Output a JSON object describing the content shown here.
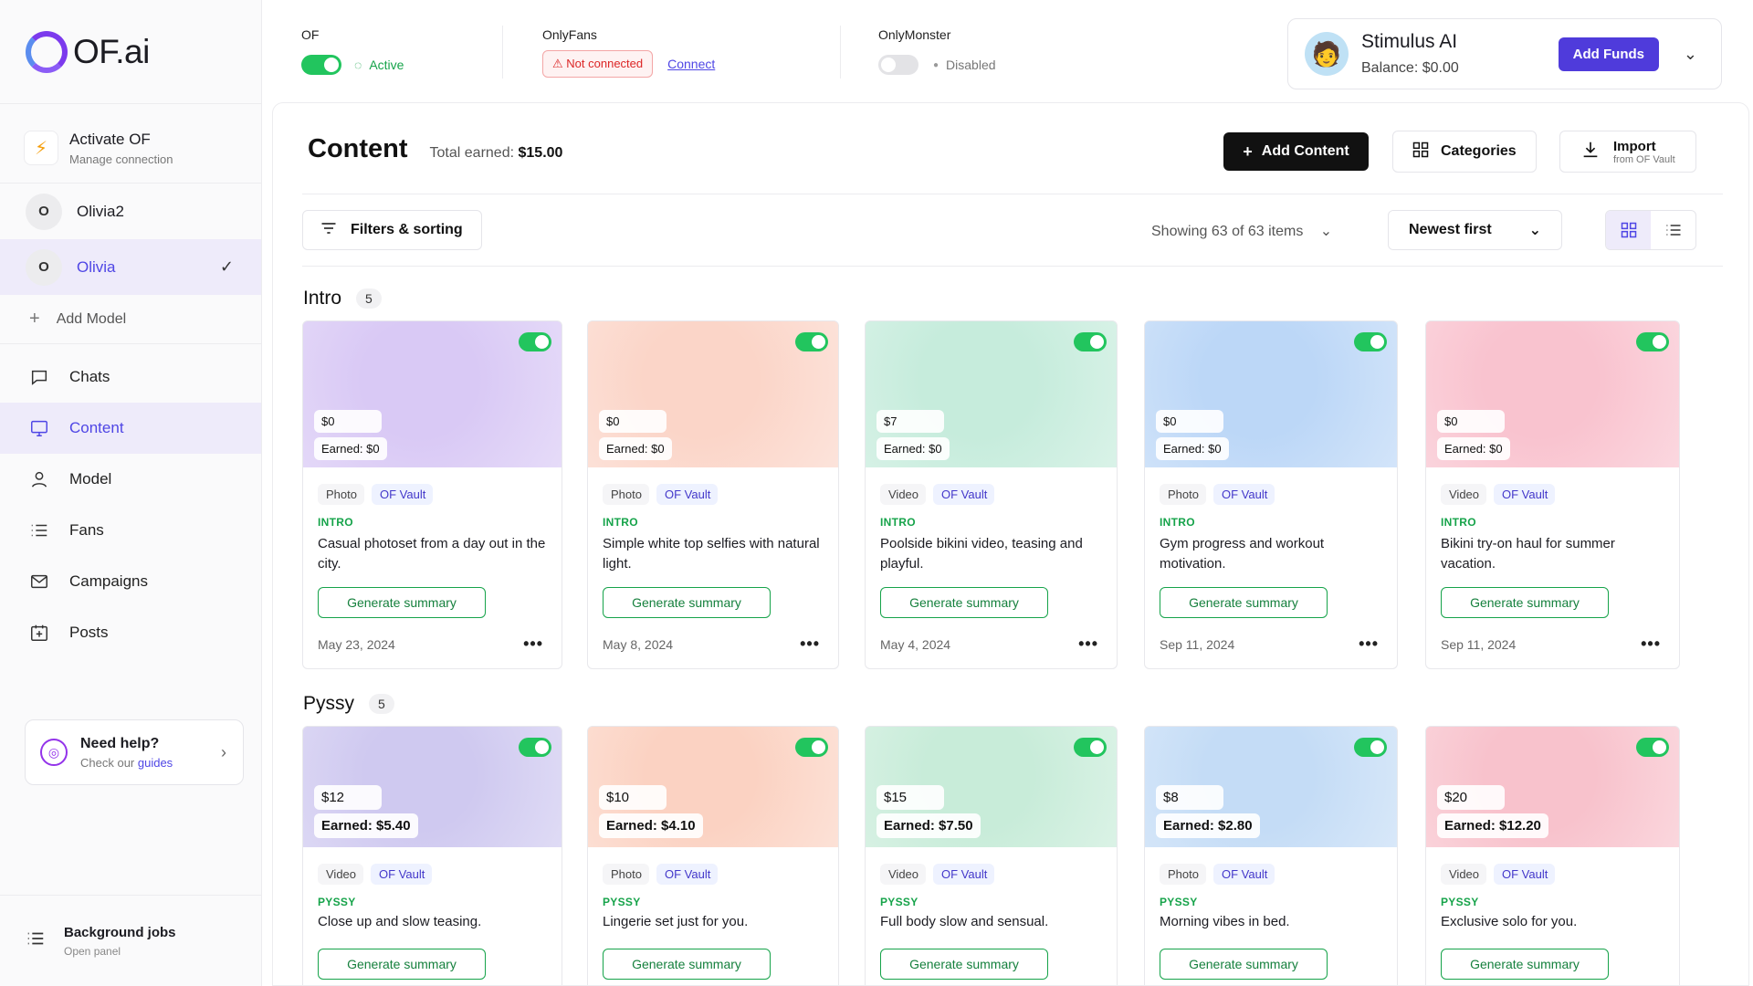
{
  "brand": {
    "name": "OF.ai"
  },
  "sidebar": {
    "activate": {
      "title": "Activate OF",
      "subtitle": "Manage connection"
    },
    "models": [
      {
        "initial": "O",
        "name": "Olivia2",
        "active": false
      },
      {
        "initial": "O",
        "name": "Olivia",
        "active": true
      }
    ],
    "add_model": "Add Model",
    "nav": [
      {
        "label": "Chats",
        "icon": "chat-icon"
      },
      {
        "label": "Content",
        "icon": "monitor-icon",
        "active": true
      },
      {
        "label": "Model",
        "icon": "person-icon"
      },
      {
        "label": "Fans",
        "icon": "list-icon"
      },
      {
        "label": "Campaigns",
        "icon": "mail-icon"
      },
      {
        "label": "Posts",
        "icon": "calendar-plus-icon"
      }
    ],
    "help": {
      "title": "Need help?",
      "sub_prefix": "Check our",
      "sub_link": "guides"
    },
    "background_jobs": {
      "title": "Background jobs",
      "subtitle": "Open panel"
    }
  },
  "topbar": {
    "of": {
      "label": "OF",
      "status": "Active"
    },
    "onlyfans": {
      "label": "OnlyFans",
      "status": "Not connected",
      "action": "Connect"
    },
    "onlymonster": {
      "label": "OnlyMonster",
      "status": "Disabled"
    },
    "account": {
      "name": "Stimulus AI",
      "balance": "Balance: $0.00",
      "add_funds": "Add Funds"
    }
  },
  "content": {
    "title": "Content",
    "total_label": "Total earned:",
    "total_value": "$15.00",
    "add_content": "Add Content",
    "categories": "Categories",
    "import_title": "Import",
    "import_sub": "from OF Vault",
    "filters": "Filters & sorting",
    "showing": "Showing 63 of 63 items",
    "sort": "Newest first",
    "generate_label": "Generate summary"
  },
  "sections": [
    {
      "title": "Intro",
      "count": "5",
      "cards": [
        {
          "price": "$0",
          "earned": "Earned: $0",
          "type": "Photo",
          "source": "OF Vault",
          "category": "INTRO",
          "desc": "Casual photoset from a day out in the city.",
          "date": "May 23, 2024",
          "color": "#d9c9f5"
        },
        {
          "price": "$0",
          "earned": "Earned: $0",
          "type": "Photo",
          "source": "OF Vault",
          "category": "INTRO",
          "desc": "Simple white top selfies with natural light.",
          "date": "May 8, 2024",
          "color": "#fbd5c8"
        },
        {
          "price": "$7",
          "earned": "Earned: $0",
          "type": "Video",
          "source": "OF Vault",
          "category": "INTRO",
          "desc": "Poolside bikini video, teasing and playful.",
          "date": "May 4, 2024",
          "color": "#c6ecdc"
        },
        {
          "price": "$0",
          "earned": "Earned: $0",
          "type": "Photo",
          "source": "OF Vault",
          "category": "INTRO",
          "desc": "Gym progress and workout motivation.",
          "date": "Sep 11, 2024",
          "color": "#bcd7f7"
        },
        {
          "price": "$0",
          "earned": "Earned: $0",
          "type": "Video",
          "source": "OF Vault",
          "category": "INTRO",
          "desc": "Bikini try-on haul for summer vacation.",
          "date": "Sep 11, 2024",
          "color": "#f9c3cf"
        }
      ]
    },
    {
      "title": "Pyssy",
      "count": "5",
      "cards": [
        {
          "price": "$12",
          "earned": "Earned: $5.40",
          "type": "Video",
          "source": "OF Vault",
          "category": "PYSSY",
          "desc": "Close up and slow teasing.",
          "color": "#cfc9f0"
        },
        {
          "price": "$10",
          "earned": "Earned: $4.10",
          "type": "Photo",
          "source": "OF Vault",
          "category": "PYSSY",
          "desc": "Lingerie set just for you.",
          "color": "#fbd2c2"
        },
        {
          "price": "$15",
          "earned": "Earned: $7.50",
          "type": "Video",
          "source": "OF Vault",
          "category": "PYSSY",
          "desc": "Full body slow and sensual.",
          "color": "#c8ecd9"
        },
        {
          "price": "$8",
          "earned": "Earned: $2.80",
          "type": "Photo",
          "source": "OF Vault",
          "category": "PYSSY",
          "desc": "Morning vibes in bed.",
          "color": "#c4dcf6"
        },
        {
          "price": "$20",
          "earned": "Earned: $12.20",
          "type": "Video",
          "source": "OF Vault",
          "category": "PYSSY",
          "desc": "Exclusive solo for you.",
          "color": "#f8c2cc"
        }
      ]
    }
  ]
}
